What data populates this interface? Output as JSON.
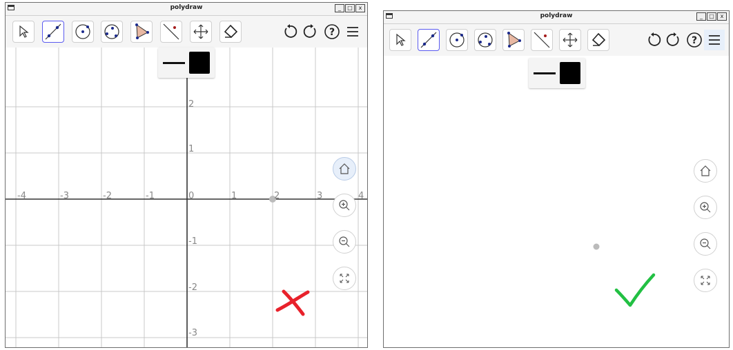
{
  "windows": [
    {
      "id": "left",
      "title": "polydraw",
      "window_buttons": [
        "_",
        "□",
        "x"
      ],
      "toolbar": {
        "tools": [
          "pointer-icon",
          "line-icon",
          "circle-center-icon",
          "circle-points-icon",
          "polygon-icon",
          "perpendicular-line-icon",
          "move-view-icon",
          "eraser-icon"
        ],
        "selected_tool": "line-icon",
        "right_buttons": [
          "undo-icon",
          "redo-icon",
          "help-icon",
          "menu-icon"
        ]
      },
      "style_popup": {
        "line_style": "solid",
        "color": "#000000"
      },
      "axes_visible": true,
      "grid_visible": true,
      "x_tick_labels": [
        "-4",
        "-3",
        "-2",
        "-1",
        "0",
        "1",
        "2",
        "3",
        "4"
      ],
      "y_tick_labels": [
        "2",
        "1",
        "-1",
        "-2",
        "-3"
      ],
      "zoom_buttons": [
        "home-icon",
        "zoom-in-icon",
        "zoom-out-icon",
        "fullscreen-icon"
      ],
      "home_active": true,
      "point": {
        "x": 2,
        "y": 0,
        "color": "#bbbbbb"
      },
      "verdict": {
        "mark": "cross",
        "color": "#e8212b"
      }
    },
    {
      "id": "right",
      "title": "polydraw",
      "window_buttons": [
        "_",
        "□",
        "x"
      ],
      "toolbar": {
        "tools": [
          "pointer-icon",
          "line-icon",
          "circle-center-icon",
          "circle-points-icon",
          "polygon-icon",
          "perpendicular-line-icon",
          "move-view-icon",
          "eraser-icon"
        ],
        "selected_tool": "line-icon",
        "right_buttons": [
          "undo-icon",
          "redo-icon",
          "help-icon",
          "menu-icon"
        ]
      },
      "style_popup": {
        "line_style": "solid",
        "color": "#000000"
      },
      "axes_visible": false,
      "grid_visible": false,
      "zoom_buttons": [
        "home-icon",
        "zoom-in-icon",
        "zoom-out-icon",
        "fullscreen-icon"
      ],
      "home_active": false,
      "point": {
        "color": "#bbbbbb"
      },
      "verdict": {
        "mark": "check",
        "color": "#22c043"
      }
    }
  ]
}
